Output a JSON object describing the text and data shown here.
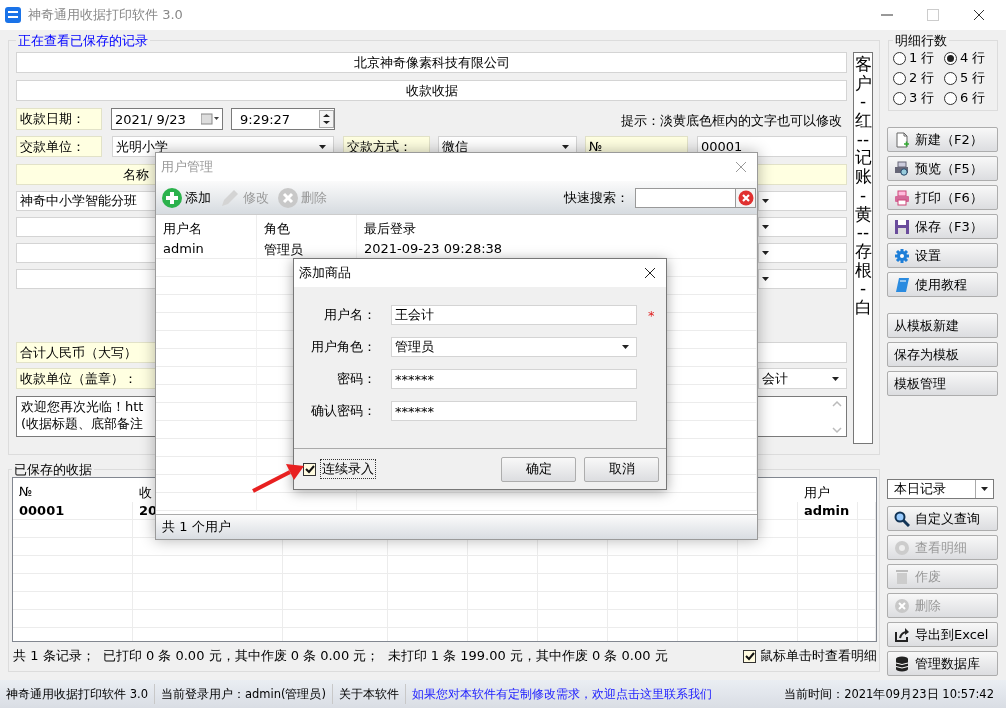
{
  "window": {
    "title": "神奇通用收据打印软件 3.0"
  },
  "receipt_form": {
    "legend": "正在查看已保存的记录",
    "company": "北京神奇像素科技有限公司",
    "receipt_title": "收款收据",
    "date_label": "收款日期：",
    "date": "2021/ 9/23",
    "time": "9:29:27",
    "hint": "提示：淡黄底色框内的文字也可以修改",
    "payer_label": "交款单位：",
    "payer": "光明小学",
    "method_label": "交款方式：",
    "method": "微信",
    "number_label": "№",
    "number": "00001",
    "item_header": "名称",
    "items": [
      {
        "name": "神奇中小学智能分班"
      }
    ],
    "total_label": "合计人民币（大写）",
    "payee_label": "收款单位（盖章）：",
    "payee": "会计",
    "remarks": [
      "欢迎您再次光临！htt",
      "(收据标题、底部备注"
    ],
    "copies_strip": "客户-红--记账-黄--存根-白"
  },
  "detail_rows": {
    "title": "明细行数",
    "options": [
      {
        "label": "1 行",
        "selected": false
      },
      {
        "label": "2 行",
        "selected": false
      },
      {
        "label": "3 行",
        "selected": false
      },
      {
        "label": "4 行",
        "selected": true
      },
      {
        "label": "5 行",
        "selected": false
      },
      {
        "label": "6 行",
        "selected": false
      }
    ]
  },
  "actions": [
    {
      "label": "新建（F2）",
      "kind": "new"
    },
    {
      "label": "预览（F5）",
      "kind": "preview"
    },
    {
      "label": "打印（F6）",
      "kind": "print"
    },
    {
      "label": "保存（F3）",
      "kind": "save"
    },
    {
      "label": "设置",
      "kind": "settings"
    },
    {
      "label": "使用教程",
      "kind": "book"
    }
  ],
  "template_actions": [
    "从模板新建",
    "保存为模板",
    "模板管理"
  ],
  "saved_receipts": {
    "title": "已保存的收据",
    "columns": [
      "№",
      "收",
      "用户"
    ],
    "rows": [
      [
        "00001",
        "20",
        "admin"
      ]
    ],
    "summary": "共 1 条记录；  已打印 0 条 0.00 元，其中作废 0 条 0.00 元；  未打印 1 条 199.00 元，其中作废 0 条 0.00 元",
    "click_view": {
      "label": "鼠标单击时查看明细",
      "checked": true
    }
  },
  "record_filter": "本日记录",
  "query_actions": [
    {
      "label": "自定义查询",
      "kind": "search",
      "disabled": false
    },
    {
      "label": "查看明细",
      "kind": "disc",
      "disabled": true
    },
    {
      "label": "作废",
      "kind": "trash",
      "disabled": true
    },
    {
      "label": "删除",
      "kind": "delete",
      "disabled": true
    },
    {
      "label": "导出到Excel",
      "kind": "export",
      "disabled": false
    },
    {
      "label": "管理数据库",
      "kind": "database",
      "disabled": false
    }
  ],
  "status_bar": {
    "app": "神奇通用收据打印软件 3.0",
    "user": "当前登录用户：admin(管理员)",
    "about": "关于本软件",
    "contact": "如果您对本软件有定制修改需求，欢迎点击这里联系我们",
    "time": "当前时间：2021年09月23日 10:57:42"
  },
  "user_dialog": {
    "title": "用户管理",
    "toolbar": [
      {
        "label": "添加",
        "kind": "add",
        "disabled": false
      },
      {
        "label": "修改",
        "kind": "edit",
        "disabled": true
      },
      {
        "label": "删除",
        "kind": "remove",
        "disabled": true
      }
    ],
    "search_label": "快速搜索：",
    "columns": [
      "用户名",
      "角色",
      "最后登录"
    ],
    "rows": [
      [
        "admin",
        "管理员",
        "2021-09-23 09:28:38"
      ]
    ],
    "footer": "共 1 个用户"
  },
  "add_dialog": {
    "title": "添加商品",
    "fields": [
      {
        "label": "用户名：",
        "value": "王会计",
        "kind": "text",
        "required_mark": "*"
      },
      {
        "label": "用户角色：",
        "value": "管理员",
        "kind": "select"
      },
      {
        "label": "密码：",
        "value": "******",
        "kind": "text"
      },
      {
        "label": "确认密码：",
        "value": "******",
        "kind": "text"
      }
    ],
    "continuous": {
      "label": "连续录入",
      "checked": true
    },
    "buttons": [
      "确定",
      "取消"
    ]
  }
}
